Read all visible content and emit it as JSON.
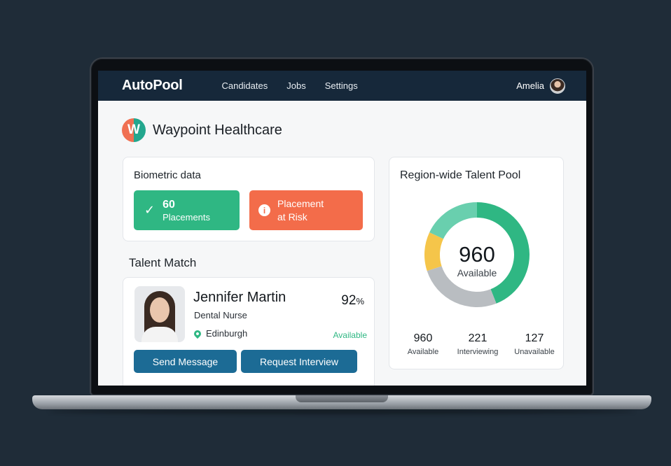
{
  "nav": {
    "brand": "AutoPool",
    "links": [
      "Candidates",
      "Jobs",
      "Settings"
    ],
    "user_name": "Amelia"
  },
  "company": {
    "logo_letter": "W",
    "name": "Waypoint Healthcare"
  },
  "biometric": {
    "title": "Biometric data",
    "placements_count": "60",
    "placements_label": "Placements",
    "risk_line1": "Placement",
    "risk_line2": "at Risk"
  },
  "talent_match": {
    "title": "Talent Match",
    "candidate": {
      "name": "Jennifer Martin",
      "role": "Dental Nurse",
      "location": "Edinburgh",
      "match_number": "92",
      "match_unit": "%",
      "status": "Available"
    },
    "buttons": {
      "send": "Send Message",
      "interview": "Request Interview"
    }
  },
  "pool": {
    "title": "Region-wide Talent Pool",
    "center_value": "960",
    "center_label": "Available",
    "stats": [
      {
        "value": "960",
        "label": "Available"
      },
      {
        "value": "221",
        "label": "Interviewing"
      },
      {
        "value": "127",
        "label": "Unavailable"
      }
    ],
    "segments": [
      {
        "name": "green",
        "color": "#2fb783",
        "fraction": 0.44
      },
      {
        "name": "gray",
        "color": "#b9bdc1",
        "fraction": 0.26
      },
      {
        "name": "yellow",
        "color": "#f5c54a",
        "fraction": 0.12
      },
      {
        "name": "teal",
        "color": "#69cfae",
        "fraction": 0.18
      }
    ]
  },
  "colors": {
    "navy": "#16283a",
    "green": "#2fb783",
    "red": "#f36c4a",
    "button_blue": "#1c6b95",
    "backdrop": "#1f2c38"
  }
}
